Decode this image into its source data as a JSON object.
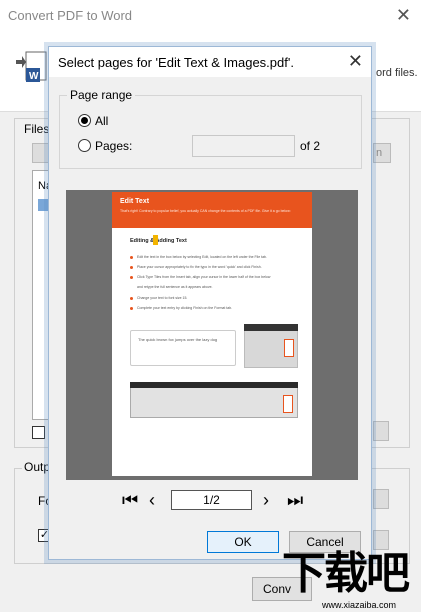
{
  "main_window": {
    "title": "Convert PDF to Word",
    "header_text_fragment": "ord files.",
    "files_label": "Files",
    "list_header": "Na",
    "right_button_fragment": "n",
    "output_label": "Outp",
    "format_label": "Fo",
    "checkbox_mark": "✓",
    "convert_label": "Conv"
  },
  "dialog": {
    "title": "Select pages for 'Edit Text & Images.pdf'.",
    "page_range_label": "Page range",
    "option_all": "All",
    "option_pages": "Pages:",
    "pages_value": "",
    "of_total": "of 2",
    "page_indicator": "1/2",
    "ok_label": "OK",
    "cancel_label": "Cancel"
  },
  "preview": {
    "banner_title": "Edit Text",
    "banner_subtitle": "That's right! Contrary to popular belief, you actually CAN change the contents of a PDF file. Give it a go below:",
    "heading": "Editing & Adding Text",
    "bullets": [
      "Edit the text in the box below by selecting Edit, located on the left under the File tab.",
      "Place your cursor appropriately to fix the typo in the word 'quick' and click Finish.",
      "Click Type Tiles from the Insert tab, align your cursor in the lower half of the box below",
      "and retype the full sentence as it appears above.",
      "Change your text to font size 15.",
      "Complete your text entry by clicking Finish on the Format tab."
    ],
    "sample_text": "The quick brown fox jumps over the lazy dog"
  },
  "watermark": {
    "main": "下载吧",
    "sub": "www.xiazaiba.com"
  }
}
